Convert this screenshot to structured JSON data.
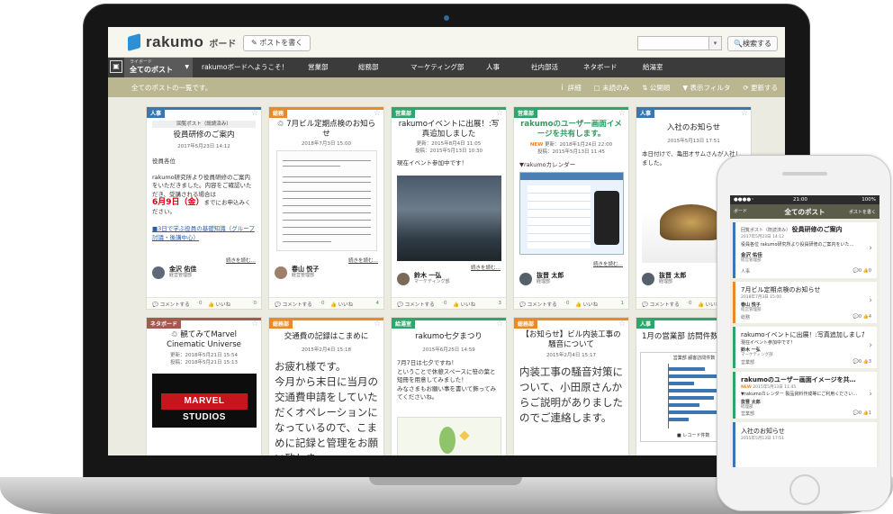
{
  "app": {
    "logo": "rakumo",
    "logo_sub": "ボード",
    "post_button": "ポストを書く",
    "search_button": "検索する",
    "search_caret": "▾"
  },
  "nav": {
    "home_icon": "▣",
    "board_small": "ライボード",
    "board_label": "全てのポスト",
    "board_caret": "▼",
    "items": [
      "rakumoボードへようこそ！",
      "営業部",
      "総務部",
      "マーケティング部",
      "人事",
      "社内部活",
      "ネタボード",
      "給湯室"
    ]
  },
  "subbar": {
    "text": "全てのポストの一覧です。",
    "tools": [
      "ｉ 詳細",
      "□ 未読のみ",
      "⇅ 公開順",
      "▼ 表示フィルタ",
      "⟳ 更新する"
    ]
  },
  "colors": {
    "jinji": "#3a77b0",
    "soumu": "#e8892b",
    "eigyo": "#2ea66b",
    "neta": "#a3594e",
    "kyuto": "#2ea66b",
    "nav": "#3b3b3b",
    "subbar": "#b9b690"
  },
  "cards": [
    {
      "tag": "人事",
      "badge": "回覧ポスト（既読済み）",
      "title": "役員研修のご案内",
      "date": "2017年5月23日 14:12",
      "body": [
        "役員各位",
        "rakumo研究所より役員研修のご案内をいただきました。内容をご確認いただき、受講される場合は",
        "6月9日（金）",
        "までにお申込みください。",
        "■3日で学ぶ役員の基礎知識（グループ討議・後講中心）"
      ],
      "more": "続きを読む…",
      "author": "金沢 佑佳",
      "dept": "経営管理部",
      "comment": "コメントする",
      "comment_count": "0",
      "like": "いいね",
      "like_count": "0"
    },
    {
      "tag": "総務",
      "title": "7月ビル定期点検のお知らせ",
      "date": "2018年7月3日 15:00",
      "more": "続きを読む…",
      "author": "春山 悦子",
      "dept": "経営管理部",
      "comment": "コメントする",
      "comment_count": "0",
      "like": "いいね",
      "like_count": "4"
    },
    {
      "tag": "営業部",
      "title": "rakumoイベントに出展！:写真追加しました",
      "meta": [
        "更新：2015年8月4日 11:05",
        "投稿：2015年5月13日 10:30"
      ],
      "body": [
        "現在イベント参加中です！"
      ],
      "more": "続きを読む…",
      "author": "鈴木 一弘",
      "dept": "マーケティング部",
      "comment": "コメントする",
      "comment_count": "0",
      "like": "いいね",
      "like_count": "3"
    },
    {
      "tag": "営業部",
      "title": "rakumoのユーザー画面イメージを共有します。",
      "new": "NEW",
      "meta": [
        "更新：2018年1月24日 22:00",
        "投稿：2015年5月13日 11:45"
      ],
      "body": [
        "▼rakumoカレンダー"
      ],
      "more": "続きを読む…",
      "author": "抜晋 太郎",
      "dept": "経理部",
      "comment": "コメントする",
      "comment_count": "0",
      "like": "いいね",
      "like_count": "1"
    },
    {
      "tag": "人事",
      "title": "入社のお知らせ",
      "date": "2015年5月13日 17:51",
      "body": [
        "本日付けで、亀田オサムさんが入社しました。"
      ],
      "more": "",
      "author": "抜晋 太郎",
      "dept": "経理部",
      "comment": "コメントする",
      "comment_count": "0",
      "like": "いいね",
      "like_count": "0"
    },
    {
      "tag": "ネタボード",
      "title": "観てみてMarvel Cinematic Universe",
      "meta": [
        "更新：2018年5月21日 15:54",
        "投稿：2018年5月21日 15:13"
      ],
      "image_text": "MARVEL STUDIOS"
    },
    {
      "tag": "総務部",
      "title": "交通費の記録はこまめに",
      "date": "2015年2月4日 15:18",
      "body": [
        "お疲れ様です。",
        "今月から末日に当月の交通費申請をしていただくオペレーションになっているので、こまめに記録と管理をお願い致しま"
      ]
    },
    {
      "tag": "給湯室",
      "title": "rakumo七夕まつり",
      "date": "2015年6月25日 14:59",
      "body": [
        "7月7日は七夕ですね！",
        "ということで休憩スペースに笹の葉と短冊を用意してみました！",
        "みなさまもお願い事を書いて飾ってみてくださいね。"
      ]
    },
    {
      "tag": "総務部",
      "title": "【お知らせ】ビル内装工事の騒音について",
      "date": "2015年2月4日 15:17",
      "body": [
        "内装工事の騒音対策について、小田原さんからご説明がありましたのでご連絡します。"
      ]
    },
    {
      "tag": "営業部",
      "title": "1月の営業部 訪問件数",
      "chart_title": "営業部 顧客訪問件数",
      "chart_axis": "■ レコード件数"
    }
  ],
  "phone": {
    "time": "21:00",
    "signal": "●●●●◦",
    "battery": "100%",
    "left": "ボード",
    "title": "全てのポスト",
    "right": "ポストを書く",
    "items": [
      {
        "badge": "回覧ポスト（既読済み）",
        "title": "役員研修のご案内",
        "date": "2017年5月23日 14:12",
        "snippet": "役員各位 rakumo研究所より役員研修のご案内をいた…",
        "author": "金沢 佑佳",
        "dept": "経営管理部",
        "tag": "人事",
        "counts": "💬0 👍0"
      },
      {
        "title": "7月ビル定期点検のお知らせ",
        "date": "2018年7月3日 15:00",
        "author": "春山 悦子",
        "dept": "経営管理部",
        "tag": "総務",
        "counts": "💬0 👍4"
      },
      {
        "title": "rakumoイベントに出展！:写真追加しました",
        "snippet": "現在イベント参加中です！",
        "author": "鈴木 一弘",
        "dept": "マーケティング部",
        "tag": "営業部",
        "counts": "💬0 👍3"
      },
      {
        "title": "rakumoのユーザー画面イメージを共…",
        "new": "NEW",
        "date": "2015年5月13日 11:45",
        "snippet": "▼rakumoカレンダー 製品資料作成等にご利用ください…",
        "author": "抜晋 太郎",
        "dept": "経理部",
        "tag": "営業部",
        "counts": "💬0 👍1"
      },
      {
        "title": "入社のお知らせ",
        "date": "2015年5月13日 17:51"
      }
    ]
  }
}
